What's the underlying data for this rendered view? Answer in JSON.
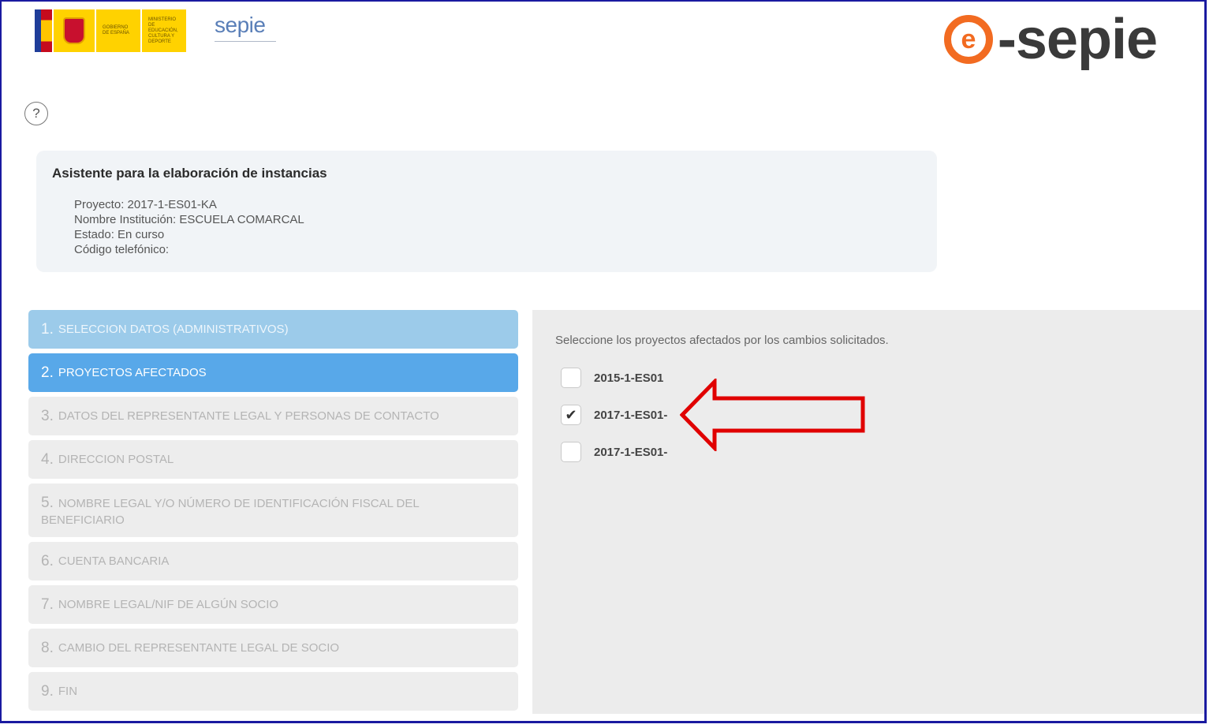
{
  "header": {
    "gov_text_1": "GOBIERNO DE ESPAÑA",
    "gov_text_2": "MINISTERIO DE EDUCACIÓN, CULTURA Y DEPORTE",
    "sepie_logo": "sepie",
    "esepie_logo_e": "e",
    "esepie_logo_text": "-sepie"
  },
  "help_icon": "?",
  "info": {
    "title": "Asistente para la elaboración de instancias",
    "project": "Proyecto: 2017-1-ES01-KA",
    "institution": "Nombre Institución: ESCUELA COMARCAL",
    "status": "Estado:  En curso",
    "phone": "Código telefónico:"
  },
  "steps": [
    {
      "num": "1.",
      "label": "SELECCION DATOS (ADMINISTRATIVOS)",
      "state": "done"
    },
    {
      "num": "2.",
      "label": "PROYECTOS AFECTADOS",
      "state": "active"
    },
    {
      "num": "3.",
      "label": "DATOS DEL REPRESENTANTE LEGAL Y PERSONAS DE CONTACTO",
      "state": "pending"
    },
    {
      "num": "4.",
      "label": "DIRECCION POSTAL",
      "state": "pending"
    },
    {
      "num": "5.",
      "label": "NOMBRE LEGAL Y/O NÚMERO DE IDENTIFICACIÓN FISCAL DEL BENEFICIARIO",
      "state": "pending"
    },
    {
      "num": "6.",
      "label": "CUENTA BANCARIA",
      "state": "pending"
    },
    {
      "num": "7.",
      "label": "NOMBRE LEGAL/NIF DE ALGÚN SOCIO",
      "state": "pending"
    },
    {
      "num": "8.",
      "label": "CAMBIO DEL REPRESENTANTE LEGAL DE SOCIO",
      "state": "pending"
    },
    {
      "num": "9.",
      "label": "FIN",
      "state": "pending"
    }
  ],
  "panel": {
    "instruction": "Seleccione los proyectos afectados por los cambios solicitados.",
    "options": [
      {
        "label": "2015-1-ES01",
        "checked": false
      },
      {
        "label": "2017-1-ES01-",
        "checked": true
      },
      {
        "label": "2017-1-ES01-",
        "checked": false
      }
    ]
  },
  "colors": {
    "active_step": "#58a8e9",
    "done_step": "#9ccbea",
    "arrow": "#e00000",
    "esepie_orange": "#f26b21"
  },
  "icons": {
    "checkmark": "✔",
    "arrow": "red-outline-arrow-left"
  }
}
